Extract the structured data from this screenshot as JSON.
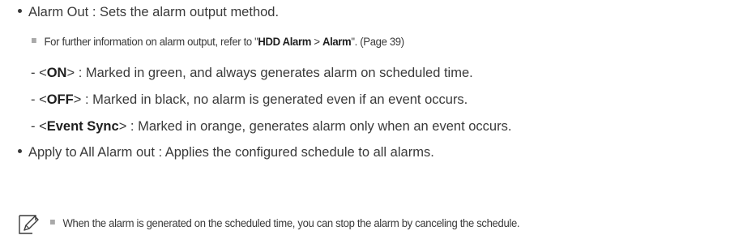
{
  "items": [
    {
      "text": "Alarm Out : Sets the alarm output method."
    },
    {
      "pre": "For further information on alarm output, refer to \"",
      "bold1": "HDD Alarm",
      "mid": " > ",
      "bold2": "Alarm",
      "post": "\". (Page 39)"
    },
    {
      "prefix": "- <",
      "label": "ON",
      "rest": "> : Marked in green, and always generates alarm on scheduled time."
    },
    {
      "prefix": "- <",
      "label": "OFF",
      "rest": "> : Marked in black, no alarm is generated even if an event occurs."
    },
    {
      "prefix": "- <",
      "label": "Event Sync",
      "rest": "> : Marked in orange, generates alarm only when an event occurs."
    },
    {
      "text": "Apply to All Alarm out : Applies the configured schedule to all alarms."
    }
  ],
  "memo": {
    "icon": "memo-pencil-icon",
    "text": "When the alarm is generated on the scheduled time, you can stop the alarm by canceling the schedule."
  }
}
